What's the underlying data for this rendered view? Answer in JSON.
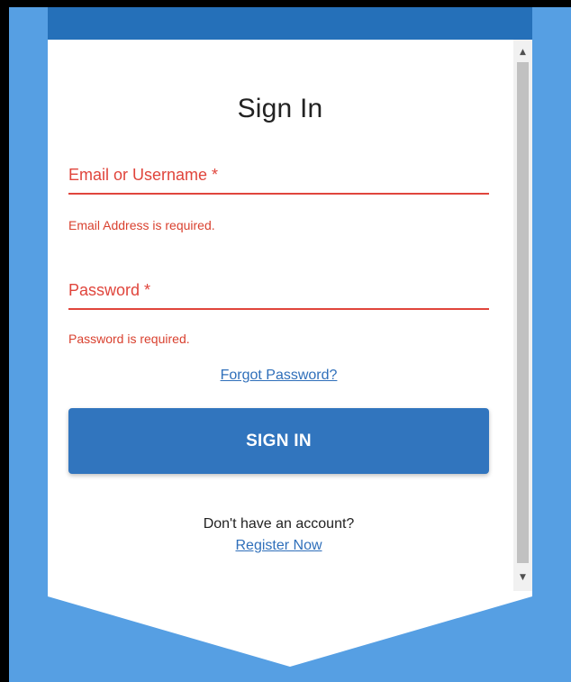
{
  "form": {
    "title": "Sign In",
    "email_label": "Email or Username *",
    "email_error": "Email Address is required.",
    "password_label": "Password *",
    "password_error": "Password is required.",
    "forgot_link": "Forgot Password?",
    "signin_button": "SIGN IN",
    "no_account_text": "Don't have an account?",
    "register_link": "Register Now"
  },
  "scrollbar": {
    "up_icon": "▲",
    "down_icon": "▼"
  },
  "colors": {
    "background": "#569fe3",
    "header_bar": "#2570b9",
    "error": "#e0453c",
    "primary_button": "#3175be",
    "link": "#2f6fba"
  }
}
